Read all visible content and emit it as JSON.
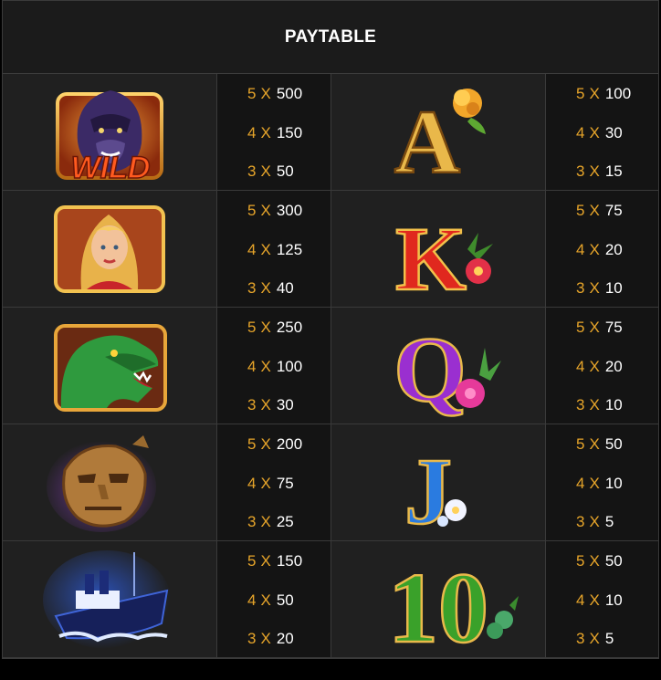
{
  "title": "PAYTABLE",
  "colors": {
    "multiplier": "#e7a52a",
    "value": "#ffffff",
    "background": "#141414"
  },
  "rows": [
    {
      "left": {
        "symbol": "wild-gorilla-icon",
        "symbol_text": "WILD",
        "pays": [
          {
            "count": "5",
            "sep": "X",
            "value": "500"
          },
          {
            "count": "4",
            "sep": "X",
            "value": "150"
          },
          {
            "count": "3",
            "sep": "X",
            "value": "50"
          }
        ]
      },
      "right": {
        "symbol": "letter-a-icon",
        "symbol_text": "A",
        "pays": [
          {
            "count": "5",
            "sep": "X",
            "value": "100"
          },
          {
            "count": "4",
            "sep": "X",
            "value": "30"
          },
          {
            "count": "3",
            "sep": "X",
            "value": "15"
          }
        ]
      }
    },
    {
      "left": {
        "symbol": "woman-portrait-icon",
        "pays": [
          {
            "count": "5",
            "sep": "X",
            "value": "300"
          },
          {
            "count": "4",
            "sep": "X",
            "value": "125"
          },
          {
            "count": "3",
            "sep": "X",
            "value": "40"
          }
        ]
      },
      "right": {
        "symbol": "letter-k-icon",
        "symbol_text": "K",
        "pays": [
          {
            "count": "5",
            "sep": "X",
            "value": "75"
          },
          {
            "count": "4",
            "sep": "X",
            "value": "20"
          },
          {
            "count": "3",
            "sep": "X",
            "value": "10"
          }
        ]
      }
    },
    {
      "left": {
        "symbol": "dinosaur-icon",
        "pays": [
          {
            "count": "5",
            "sep": "X",
            "value": "250"
          },
          {
            "count": "4",
            "sep": "X",
            "value": "100"
          },
          {
            "count": "3",
            "sep": "X",
            "value": "30"
          }
        ]
      },
      "right": {
        "symbol": "letter-q-icon",
        "symbol_text": "Q",
        "pays": [
          {
            "count": "5",
            "sep": "X",
            "value": "75"
          },
          {
            "count": "4",
            "sep": "X",
            "value": "20"
          },
          {
            "count": "3",
            "sep": "X",
            "value": "10"
          }
        ]
      }
    },
    {
      "left": {
        "symbol": "golden-mask-icon",
        "pays": [
          {
            "count": "5",
            "sep": "X",
            "value": "200"
          },
          {
            "count": "4",
            "sep": "X",
            "value": "75"
          },
          {
            "count": "3",
            "sep": "X",
            "value": "25"
          }
        ]
      },
      "right": {
        "symbol": "letter-j-icon",
        "symbol_text": "J",
        "pays": [
          {
            "count": "5",
            "sep": "X",
            "value": "50"
          },
          {
            "count": "4",
            "sep": "X",
            "value": "10"
          },
          {
            "count": "3",
            "sep": "X",
            "value": "5"
          }
        ]
      }
    },
    {
      "left": {
        "symbol": "steamship-icon",
        "pays": [
          {
            "count": "5",
            "sep": "X",
            "value": "150"
          },
          {
            "count": "4",
            "sep": "X",
            "value": "50"
          },
          {
            "count": "3",
            "sep": "X",
            "value": "20"
          }
        ]
      },
      "right": {
        "symbol": "number-10-icon",
        "symbol_text": "10",
        "pays": [
          {
            "count": "5",
            "sep": "X",
            "value": "50"
          },
          {
            "count": "4",
            "sep": "X",
            "value": "10"
          },
          {
            "count": "3",
            "sep": "X",
            "value": "5"
          }
        ]
      }
    }
  ]
}
